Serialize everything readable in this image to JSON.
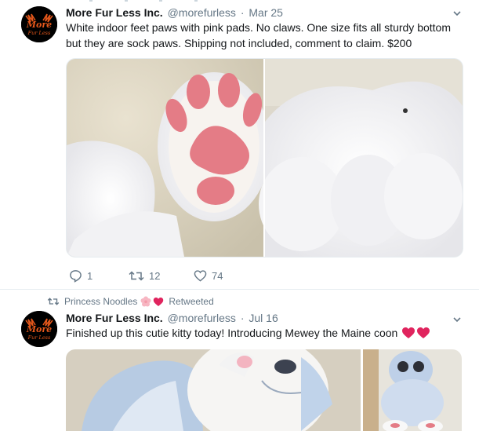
{
  "tweets": [
    {
      "name": "More Fur Less Inc.",
      "handle": "@morefurless",
      "date": "Mar 25",
      "text": "White indoor feet paws with pink pads. No claws. One size fits all sturdy bottom but they are sock paws. Shipping not included, comment to claim. $200",
      "replies": "1",
      "retweets": "12",
      "likes": "74",
      "avatar_text": [
        "More",
        "Fur Less"
      ]
    },
    {
      "retweeted_by": "Princess Noodles",
      "retweeted_label": "Retweeted",
      "name": "More Fur Less Inc.",
      "handle": "@morefurless",
      "date": "Jul 16",
      "text": "Finished up this cutie kitty today! Introducing Mewey the Maine coon",
      "avatar_text": [
        "More",
        "Fur Less"
      ]
    }
  ],
  "colors": {
    "link_gray": "#657786",
    "brand_orange": "#e4571b",
    "pad_pink": "#e47c86",
    "heart_red": "#e0245e"
  },
  "icons": [
    "reply-icon",
    "retweet-icon",
    "like-icon",
    "caret-down-icon",
    "flower-emoji",
    "heart-emoji"
  ]
}
